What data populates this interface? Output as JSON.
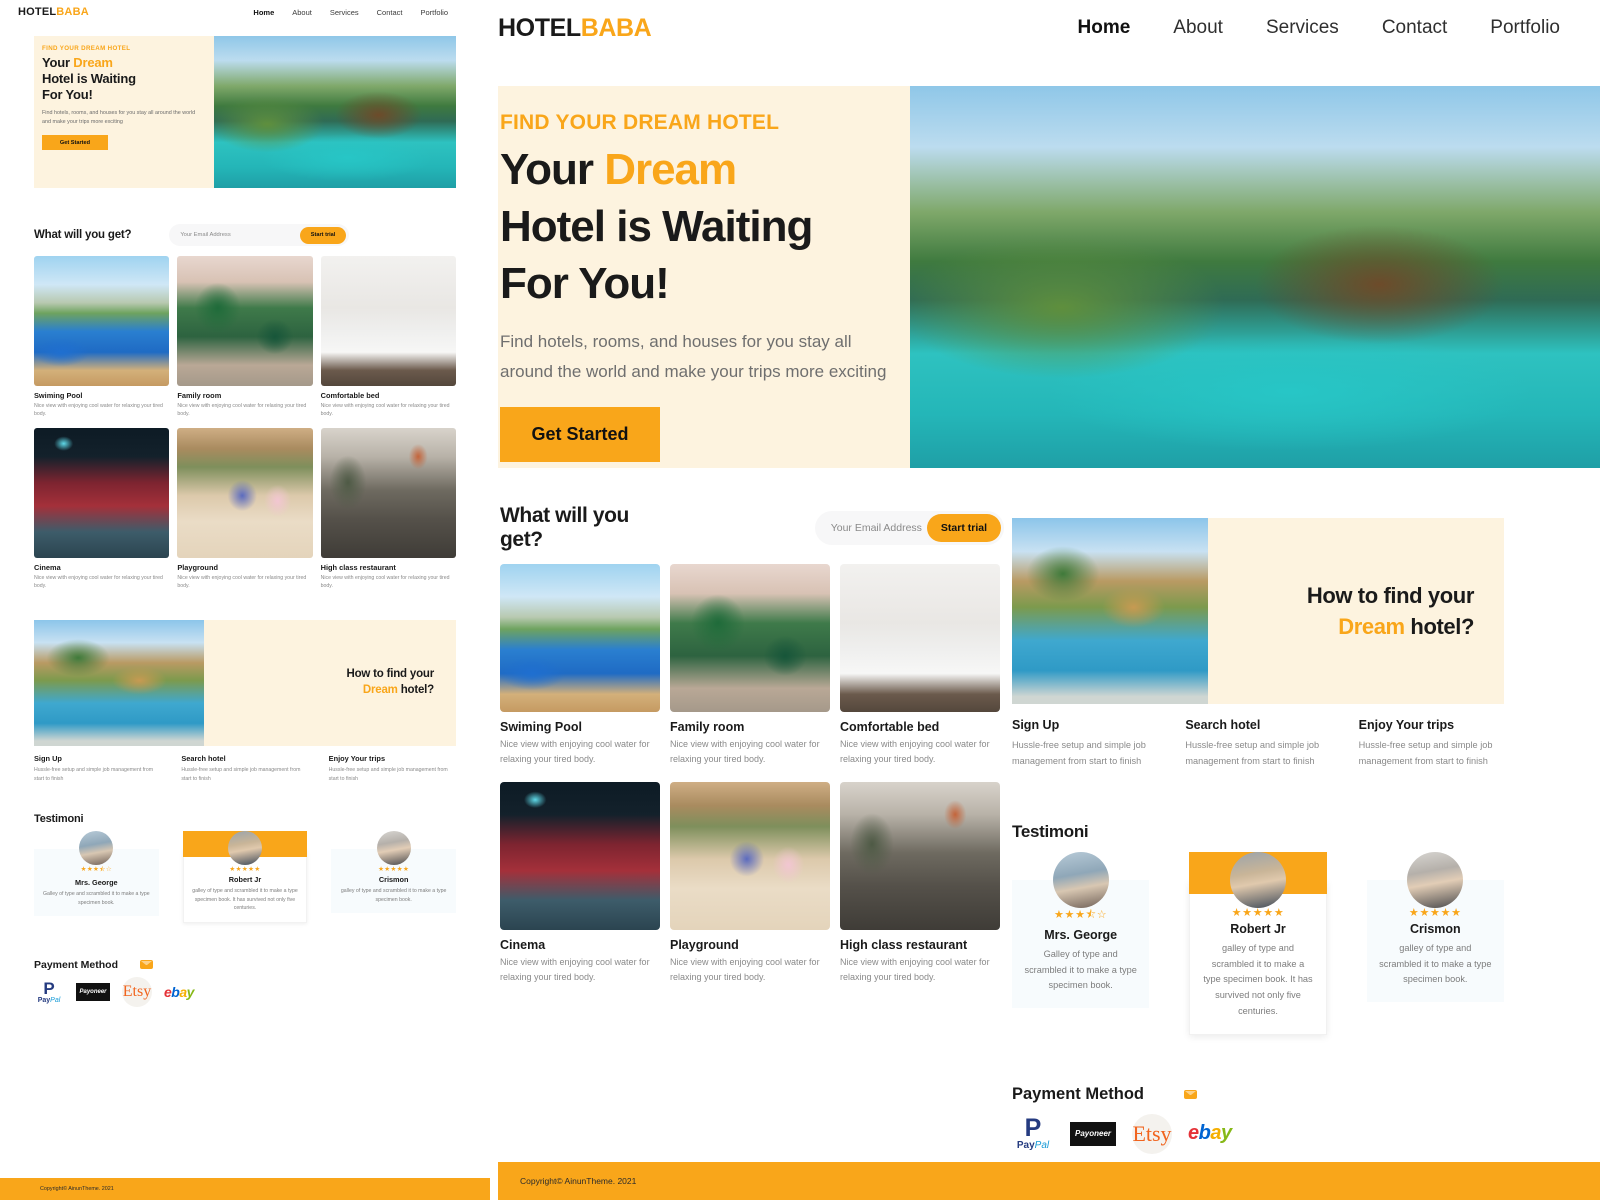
{
  "brand": {
    "name_dark": "HOTEL",
    "name_accent": "BABA",
    "accent_color": "#F9A61A",
    "cream_color": "#FDF3DF"
  },
  "nav": {
    "items": [
      {
        "label": "Home",
        "active": true
      },
      {
        "label": "About",
        "active": false
      },
      {
        "label": "Services",
        "active": false
      },
      {
        "label": "Contact",
        "active": false
      },
      {
        "label": "Portfolio",
        "active": false
      }
    ]
  },
  "hero": {
    "eyebrow": "FIND YOUR DREAM HOTEL",
    "title_line1_a": "Your ",
    "title_line1_b": "Dream",
    "title_line2": "Hotel is Waiting",
    "title_line3": "For You!",
    "subtitle": "Find hotels, rooms, and houses for you stay all around the world and make your trips more exciting",
    "cta_label": "Get Started",
    "image_name": "tropical-resort-pool-hero"
  },
  "features": {
    "section_title": "What will you get?",
    "email_placeholder": "Your Email Address",
    "email_value": "",
    "trial_button_label": "Start trial",
    "cards": [
      {
        "title": "Swiming Pool",
        "desc": "Nice view with enjoying cool water for relaxing your tired body.",
        "image_name": "swimming-pool-photo"
      },
      {
        "title": "Family room",
        "desc": "Nice view with enjoying cool water for relaxing your tired body.",
        "image_name": "family-room-photo"
      },
      {
        "title": "Comfortable bed",
        "desc": "Nice view with enjoying cool water for relaxing your tired body.",
        "image_name": "comfortable-bed-photo"
      },
      {
        "title": "Cinema",
        "desc": "Nice view with enjoying cool water for relaxing your tired body.",
        "image_name": "cinema-photo"
      },
      {
        "title": "Playground",
        "desc": "Nice view with enjoying cool water for relaxing your tired body.",
        "image_name": "playground-photo"
      },
      {
        "title": "High class restaurant",
        "desc": "Nice view with enjoying cool water for relaxing your tired body.",
        "image_name": "restaurant-photo"
      }
    ]
  },
  "how": {
    "heading_line1": "How to find your",
    "heading_accent": "Dream",
    "heading_rest": " hotel?",
    "image_name": "beach-resort-pool-photo",
    "steps": [
      {
        "title": "Sign Up",
        "desc": "Hussle-free setup and simple job management from start to finish"
      },
      {
        "title": "Search hotel",
        "desc": "Hussle-free setup and simple job management from start to finish"
      },
      {
        "title": "Enjoy Your trips",
        "desc": "Hussle-free setup and simple job management from start to finish"
      }
    ]
  },
  "testimonials": {
    "section_title": "Testimoni",
    "items": [
      {
        "name": "Mrs. George",
        "stars": "★★★⯪☆",
        "rating": 3.5,
        "text": "Galley of type and scrambled it to make a type specimen book.",
        "featured": false,
        "avatar_name": "avatar-mrs-george"
      },
      {
        "name": "Robert Jr",
        "stars": "★★★★★",
        "rating": 5,
        "text": "galley of type and scrambled it to make a type specimen book. It has survived not only five centuries.",
        "featured": true,
        "avatar_name": "avatar-robert-jr"
      },
      {
        "name": "Crismon",
        "stars": "★★★★★",
        "rating": 5,
        "text": "galley of type and scrambled it to make a type specimen book.",
        "featured": false,
        "avatar_name": "avatar-crismon"
      }
    ]
  },
  "payment": {
    "section_title": "Payment Method",
    "icon_name": "mail-icon",
    "methods": [
      {
        "name": "PayPal",
        "glyph": "P",
        "word_bold": "Pay",
        "word_light": "Pal"
      },
      {
        "name": "Payoneer",
        "label": "Payoneer"
      },
      {
        "name": "Etsy",
        "label": "Etsy"
      },
      {
        "name": "ebay",
        "letters": [
          "e",
          "b",
          "a",
          "y"
        ]
      }
    ]
  },
  "footer": {
    "copyright": "Copyright© AinunTheme. 2021"
  }
}
